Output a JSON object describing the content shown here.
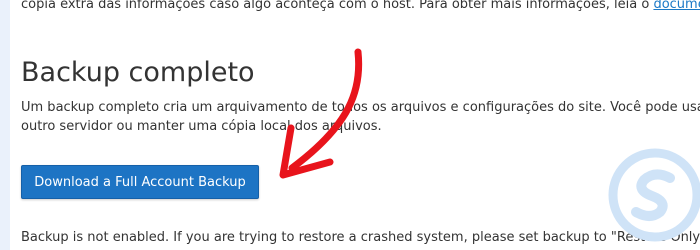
{
  "intro": {
    "text": "cópia extra das informações caso algo aconteça com o host. Para obter mais informações, leia o ",
    "link_text": "docume"
  },
  "section": {
    "title": "Backup completo",
    "description_line1": "Um backup completo cria um arquivamento de todos os arquivos e configurações do site. Você pode usa",
    "description_line2": "outro servidor ou manter uma cópia local dos arquivos."
  },
  "actions": {
    "download_full_backup_label": "Download a Full Account Backup"
  },
  "status": {
    "message": "Backup is not enabled. If you are trying to restore a crashed system, please set backup to \"Restore Only\""
  },
  "colors": {
    "button": "#1d74c4",
    "arrow": "#e8141c",
    "link": "#1a78c6",
    "watermark": "#cfe3f7"
  },
  "icons": {
    "annotation": "red-arrow-icon",
    "watermark": "brand-logo-icon"
  }
}
